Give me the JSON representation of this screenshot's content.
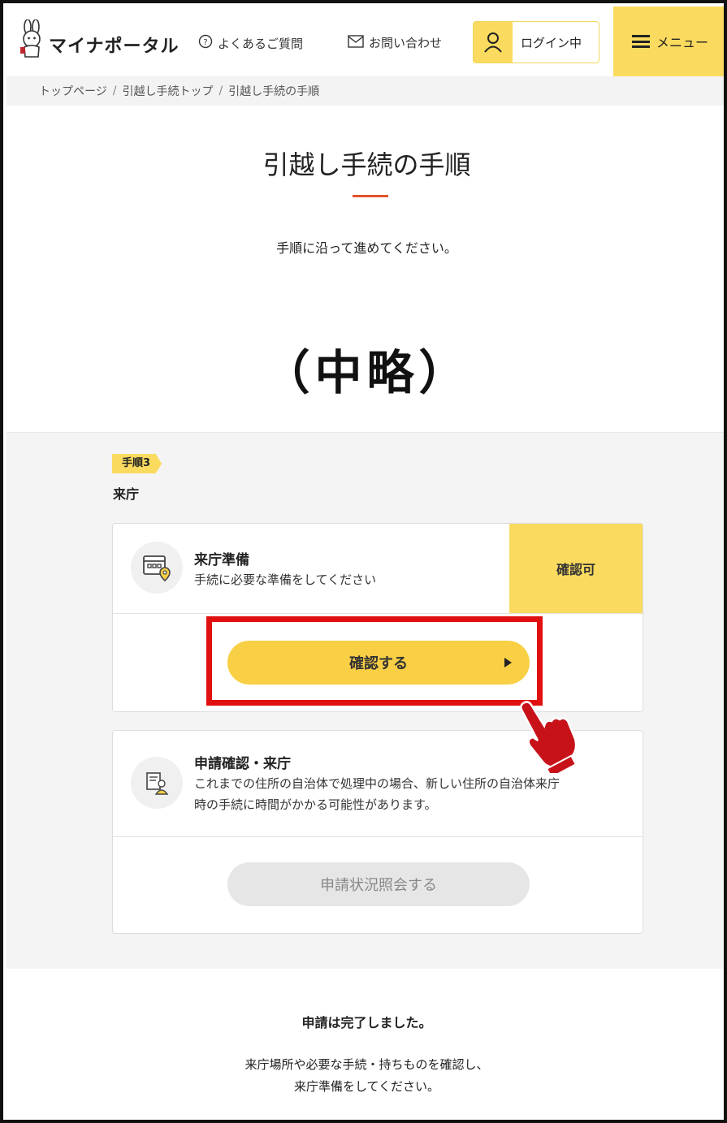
{
  "header": {
    "logo_text": "マイナポータル",
    "faq_label": "よくあるご質問",
    "contact_label": "お問い合わせ",
    "login_label": "ログイン中",
    "menu_label": "メニュー"
  },
  "breadcrumb": {
    "items": [
      "トップページ",
      "引越し手続トップ",
      "引越し手続の手順"
    ],
    "separator": "/"
  },
  "page": {
    "title": "引越し手続の手順",
    "lead": "手順に沿って進めてください。",
    "omitted_text": "（中略）"
  },
  "step": {
    "badge": "手順3",
    "name": "来庁",
    "cards": [
      {
        "title": "来庁準備",
        "description": "手続に必要な準備をしてください",
        "status": "確認可",
        "button_label": "確認する"
      },
      {
        "title": "申請確認・来庁",
        "description_lines": [
          "これまでの住所の自治体で処理中の場合、新しい住所の自治体来庁",
          "時の手続に時間がかかる可能性があります。"
        ],
        "button_label": "申請状況照会する"
      }
    ]
  },
  "footer": {
    "done_text": "申請は完了しました。",
    "note_lines": [
      "来庁場所や必要な手続・持ちものを確認し、",
      "来庁準備をしてください。"
    ]
  },
  "colors": {
    "accent_yellow": "#fadb5f",
    "button_yellow": "#f9cf45",
    "title_rule": "#e2542b",
    "highlight_red": "#e01010",
    "disabled_gray": "#e6e6e6"
  },
  "icons": [
    "rabbit-mascot-icon",
    "question-circle-icon",
    "mail-icon",
    "user-icon",
    "hamburger-menu-icon",
    "calendar-location-icon",
    "document-person-icon",
    "pointing-hand-icon"
  ]
}
